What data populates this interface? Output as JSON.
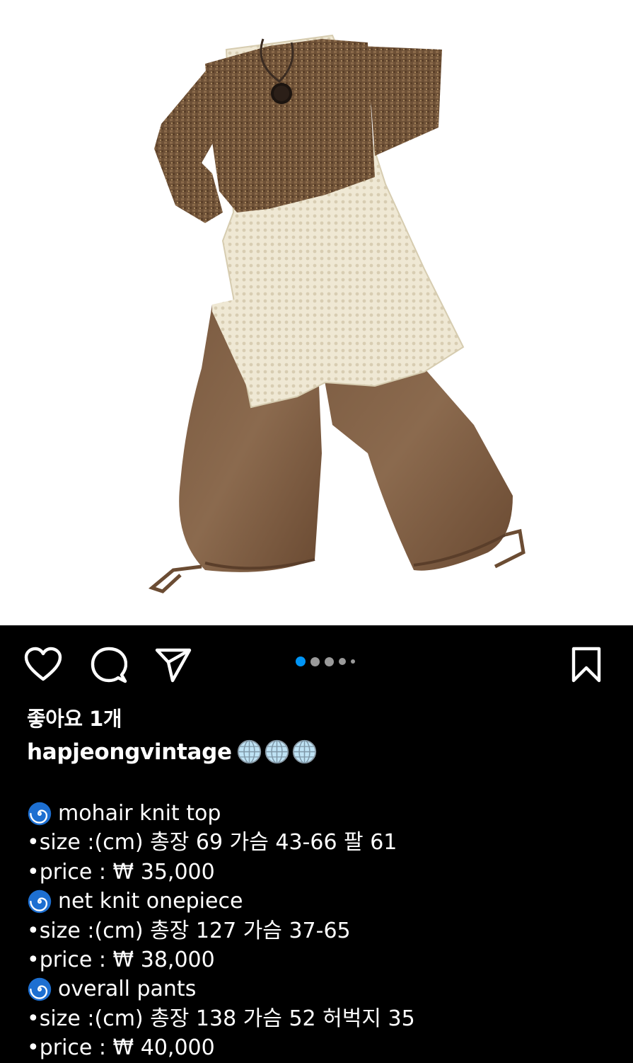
{
  "post": {
    "likes_text": "좋아요 1개",
    "username": "hapjeong​vintage",
    "username_emojis": [
      "globe-icon",
      "globe-icon",
      "globe-icon"
    ],
    "carousel": {
      "count": 5,
      "active_index": 0
    },
    "caption_lines": [
      {
        "emoji": "swirl-icon",
        "text": "mohair knit top"
      },
      {
        "emoji": "",
        "text": "•size :(cm) 총장 69 가슴 43-66 팔 61"
      },
      {
        "emoji": "",
        "text": "•price : ₩ 35,000"
      },
      {
        "emoji": "swirl-icon",
        "text": "net knit onepiece"
      },
      {
        "emoji": "",
        "text": "•size :(cm) 총장 127 가슴 37-65"
      },
      {
        "emoji": "",
        "text": "•price : ₩ 38,000"
      },
      {
        "emoji": "swirl-icon",
        "text": "overall pants"
      },
      {
        "emoji": "",
        "text": "•size :(cm) 총장 138 가슴 52 허벅지 35"
      },
      {
        "emoji": "",
        "text": "•price : ₩ 40,000"
      }
    ]
  },
  "colors": {
    "background": "#000000",
    "text": "#ffffff",
    "active_dot": "#0095f6",
    "inactive_dot": "#9a9a9a",
    "swirl": "#1d6fd1"
  }
}
